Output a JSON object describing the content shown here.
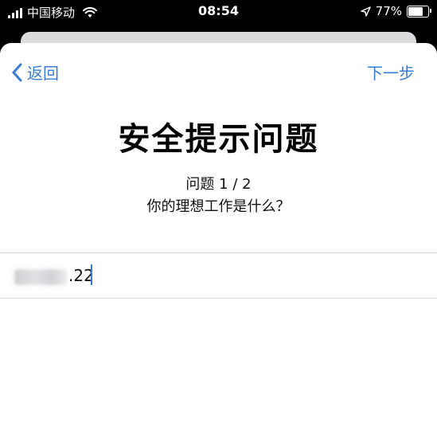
{
  "status_bar": {
    "carrier": "中国移动",
    "time": "08:54",
    "battery": "77%",
    "battery_level": 0.77
  },
  "nav": {
    "back_label": "返回",
    "next_label": "下一步"
  },
  "title": "安全提示问题",
  "question": {
    "count": "问题 1 / 2",
    "text": "你的理想工作是什么？"
  },
  "answer": {
    "visible_suffix": ".22"
  },
  "colors": {
    "accent": "#3a7bd5",
    "background": "#ffffff",
    "status_bar": "#000000"
  },
  "icons": {
    "back": "chevron-left-icon",
    "wifi": "wifi-icon",
    "location": "location-arrow-icon",
    "battery": "battery-icon",
    "signal": "signal-bars-icon"
  }
}
